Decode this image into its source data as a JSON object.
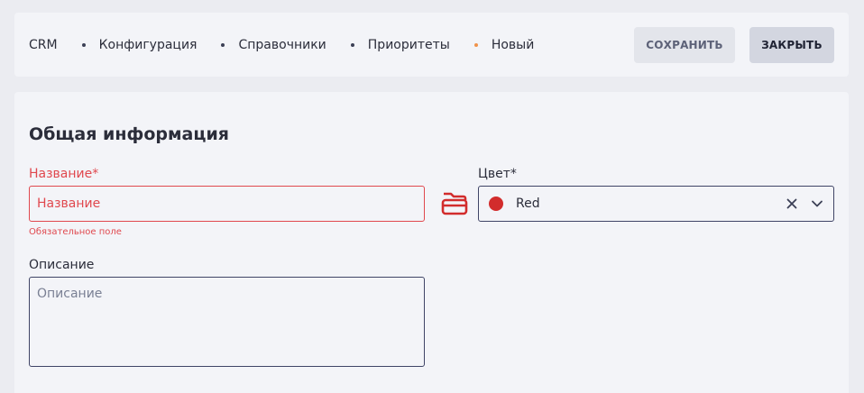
{
  "breadcrumb": {
    "items": [
      "CRM",
      "Конфигурация",
      "Справочники",
      "Приоритеты",
      "Новый"
    ]
  },
  "toolbar": {
    "save_label": "СОХРАНИТЬ",
    "close_label": "ЗАКРЫТЬ"
  },
  "form": {
    "section_title": "Общая информация",
    "name": {
      "label": "Название*",
      "placeholder": "Название",
      "value": "",
      "error": "Обязательное поле"
    },
    "color": {
      "label": "Цвет*",
      "value": "Red",
      "swatch": "#d22c2c"
    },
    "description": {
      "label": "Описание",
      "placeholder": "Описание",
      "value": ""
    }
  },
  "icons": {
    "folder": "folder-open-icon",
    "clear": "close-icon",
    "dropdown": "chevron-down-icon"
  },
  "colors": {
    "error": "#e0484e",
    "accent_dot": "#f0924a"
  }
}
